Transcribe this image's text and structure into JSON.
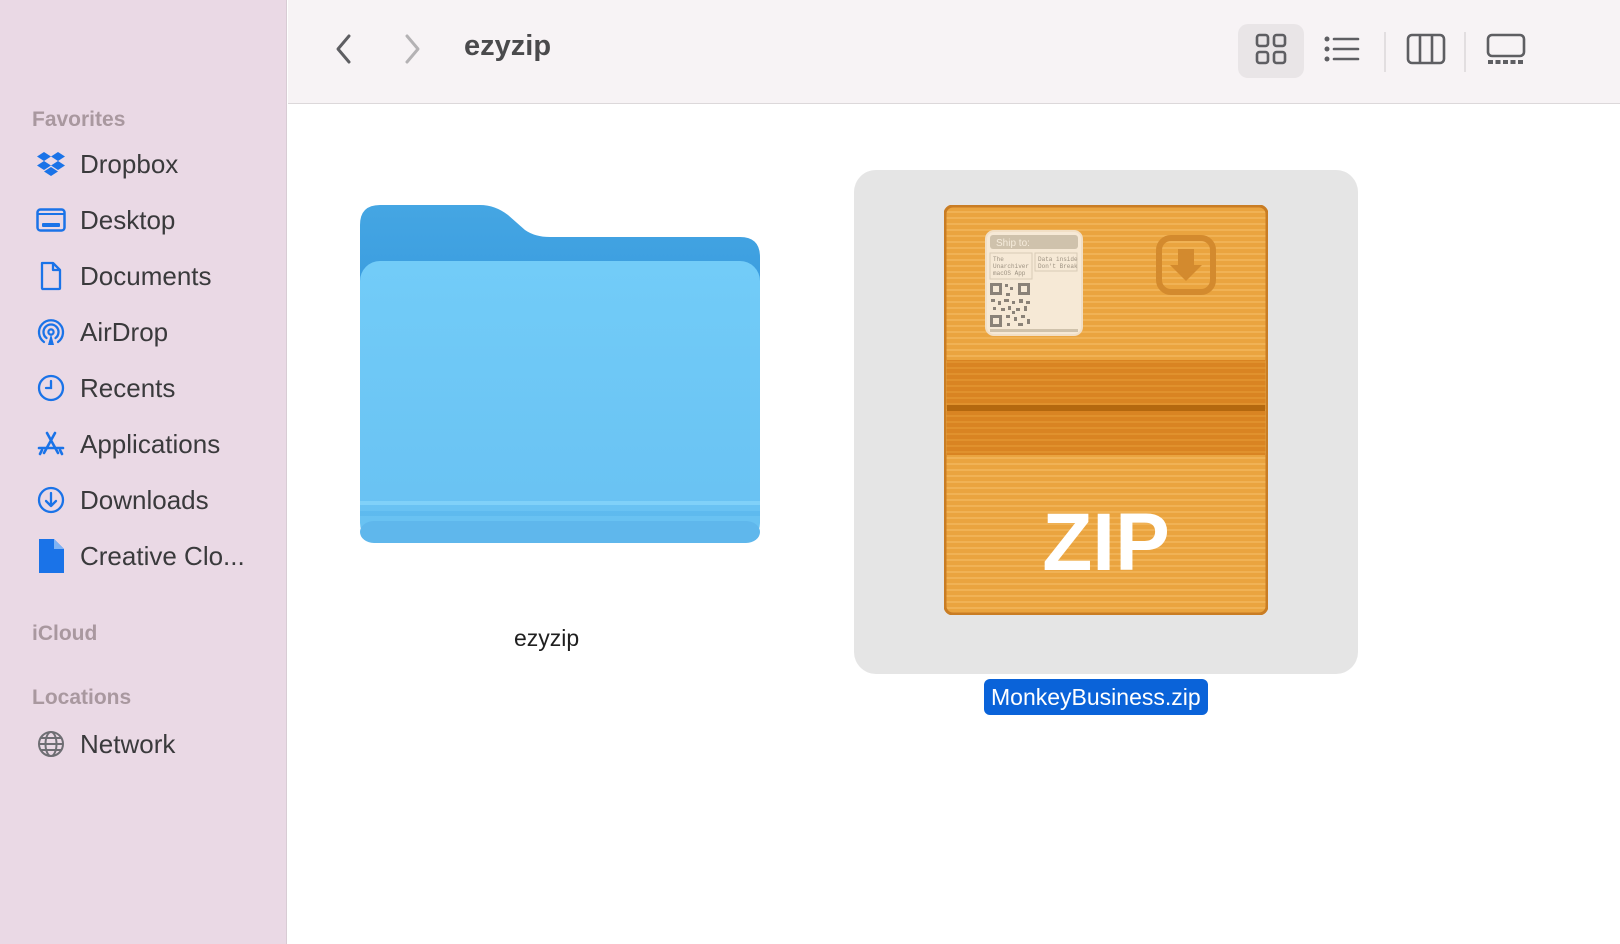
{
  "window": {
    "title": "ezyzip"
  },
  "toolbar": {
    "back_icon": "chevron-left-icon",
    "forward_icon": "chevron-right-icon",
    "views": [
      {
        "name": "icon-view",
        "icon": "grid-icon",
        "active": true
      },
      {
        "name": "list-view",
        "icon": "list-icon",
        "active": false
      },
      {
        "name": "column-view",
        "icon": "columns-icon",
        "active": false
      },
      {
        "name": "gallery-view",
        "icon": "gallery-icon",
        "active": false
      }
    ]
  },
  "sidebar": {
    "sections": {
      "favorites": "Favorites",
      "icloud": "iCloud",
      "locations": "Locations"
    },
    "favorites": [
      {
        "label": "Dropbox",
        "icon": "dropbox-icon"
      },
      {
        "label": "Desktop",
        "icon": "desktop-icon"
      },
      {
        "label": "Documents",
        "icon": "document-icon"
      },
      {
        "label": "AirDrop",
        "icon": "airdrop-icon"
      },
      {
        "label": "Recents",
        "icon": "clock-icon"
      },
      {
        "label": "Applications",
        "icon": "applications-icon"
      },
      {
        "label": "Downloads",
        "icon": "download-icon"
      },
      {
        "label": "Creative Clo...",
        "icon": "file-icon"
      }
    ],
    "locations": [
      {
        "label": "Network",
        "icon": "globe-icon"
      }
    ],
    "accent_color": "#1a73e8"
  },
  "files": [
    {
      "name": "ezyzip",
      "type": "folder",
      "selected": false
    },
    {
      "name": "MonkeyBusiness.zip",
      "type": "zip-archive",
      "selected": true,
      "icon_text": "ZIP",
      "label_ship_to": "Ship to:",
      "label_address": [
        "The",
        "Unarchiver",
        "macOS App"
      ],
      "label_note": [
        "Data inside",
        "Don't Break"
      ]
    }
  ],
  "colors": {
    "sidebar_bg": "#ead9e5",
    "selection": "#0a63d9",
    "folder_front": "#6ec6f5",
    "folder_back": "#3b9fe0",
    "zip_orange": "#e9a13b"
  }
}
